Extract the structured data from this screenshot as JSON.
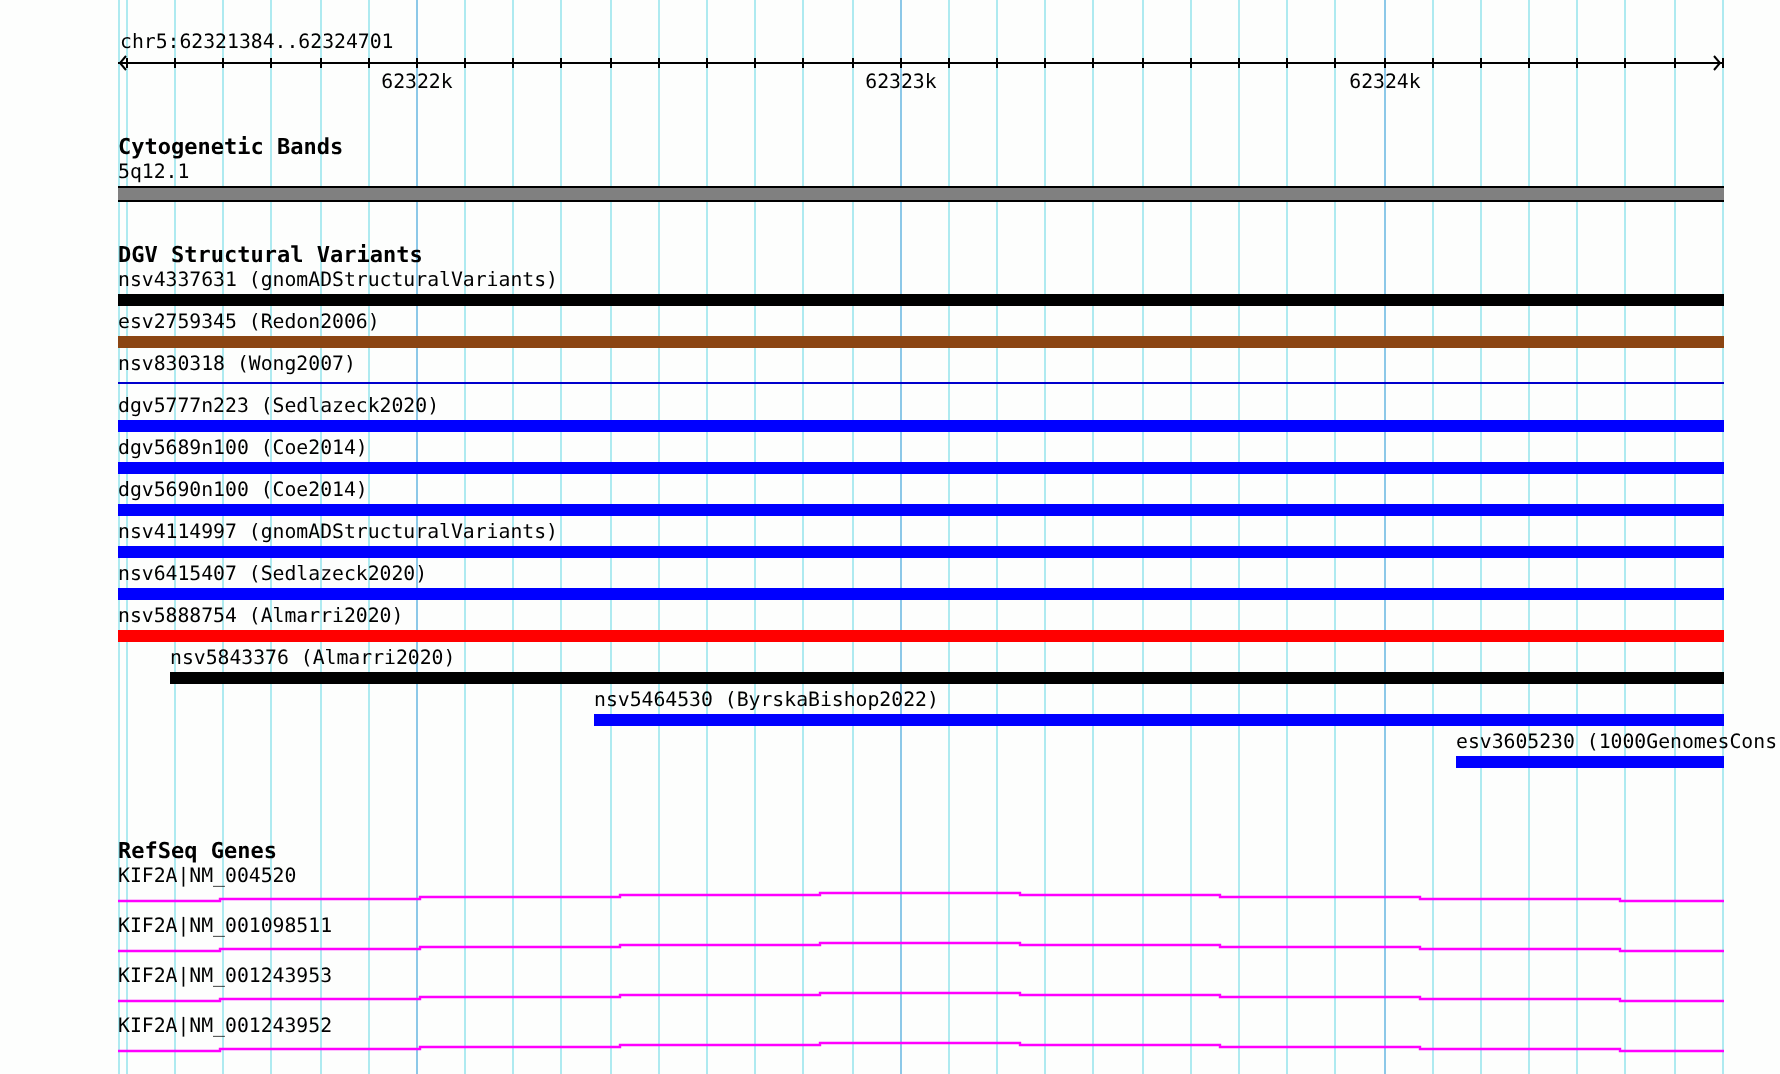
{
  "location": "chr5:62321384..62324701",
  "ruler": {
    "tick_labels": [
      "62322k",
      "62323k",
      "62324k"
    ]
  },
  "tracks": [
    {
      "title": "Cytogenetic Bands",
      "kind": "bands",
      "features": [
        {
          "label": "5q12.1"
        }
      ]
    },
    {
      "title": "DGV Structural Variants",
      "kind": "variants",
      "features": [
        {
          "label": "nsv4337631 (gnomADStructuralVariants)",
          "color": "#000000",
          "kind": "bar"
        },
        {
          "label": "esv2759345 (Redon2006)",
          "color": "#8b4513",
          "kind": "bar"
        },
        {
          "label": "nsv830318 (Wong2007)",
          "color": "#0000cc",
          "kind": "line"
        },
        {
          "label": "dgv5777n223 (Sedlazeck2020)",
          "color": "#0000ff",
          "kind": "bar"
        },
        {
          "label": "dgv5689n100 (Coe2014)",
          "color": "#0000ff",
          "kind": "bar"
        },
        {
          "label": "dgv5690n100 (Coe2014)",
          "color": "#0000ff",
          "kind": "bar"
        },
        {
          "label": "nsv4114997 (gnomADStructuralVariants)",
          "color": "#0000ff",
          "kind": "bar"
        },
        {
          "label": "nsv6415407 (Sedlazeck2020)",
          "color": "#0000ff",
          "kind": "bar"
        },
        {
          "label": "nsv5888754 (Almarri2020)",
          "color": "#ff0000",
          "kind": "bar"
        },
        {
          "label": "nsv5843376 (Almarri2020)",
          "color": "#000000",
          "kind": "bar"
        },
        {
          "label": "nsv5464530 (ByrskaBishop2022)",
          "color": "#0000ff",
          "kind": "bar"
        },
        {
          "label": "esv3605230 (1000GenomesCons",
          "color": "#0000ff",
          "kind": "bar"
        }
      ]
    },
    {
      "title": "RefSeq Genes",
      "kind": "genes",
      "features": [
        {
          "label": "KIF2A|NM_004520"
        },
        {
          "label": "KIF2A|NM_001098511"
        },
        {
          "label": "KIF2A|NM_001243953"
        },
        {
          "label": "KIF2A|NM_001243952"
        }
      ]
    }
  ]
}
